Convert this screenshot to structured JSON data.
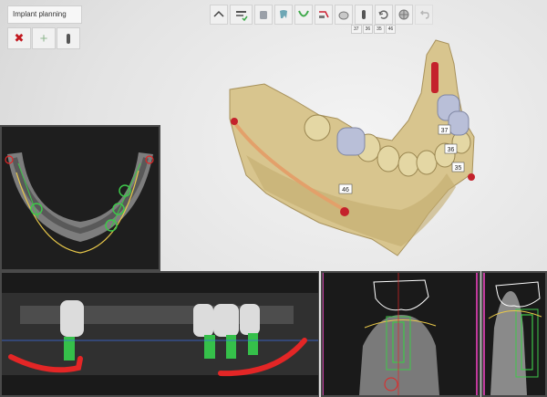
{
  "panel": {
    "title": "Implant planning",
    "tools": [
      {
        "icon": "close-icon",
        "glyph": "✖"
      },
      {
        "icon": "plus-icon",
        "glyph": "+"
      },
      {
        "icon": "implant-icon",
        "glyph": ""
      }
    ]
  },
  "toolbar": {
    "icons": [
      "chevron-up-icon",
      "nerve-tracing-icon",
      "crown-icon",
      "tooth-icon",
      "arch-icon",
      "scan-icon",
      "sphere-icon",
      "implant-icon",
      "rotate-icon",
      "globe-icon",
      "undo-icon"
    ],
    "tooth_numbers": [
      "37",
      "36",
      "35",
      "46"
    ]
  },
  "viewport": {
    "labels": [
      "37",
      "36",
      "35",
      "46"
    ],
    "colors": {
      "bone": "#d8c58e",
      "nerve": "#e3a06a",
      "crown": "#b9bfd8",
      "implant": "#c4222c"
    }
  },
  "slices": {
    "colors": {
      "nerve_canal": "#e32626",
      "implant": "#35c04a",
      "axis": "#3a6ee8"
    }
  }
}
